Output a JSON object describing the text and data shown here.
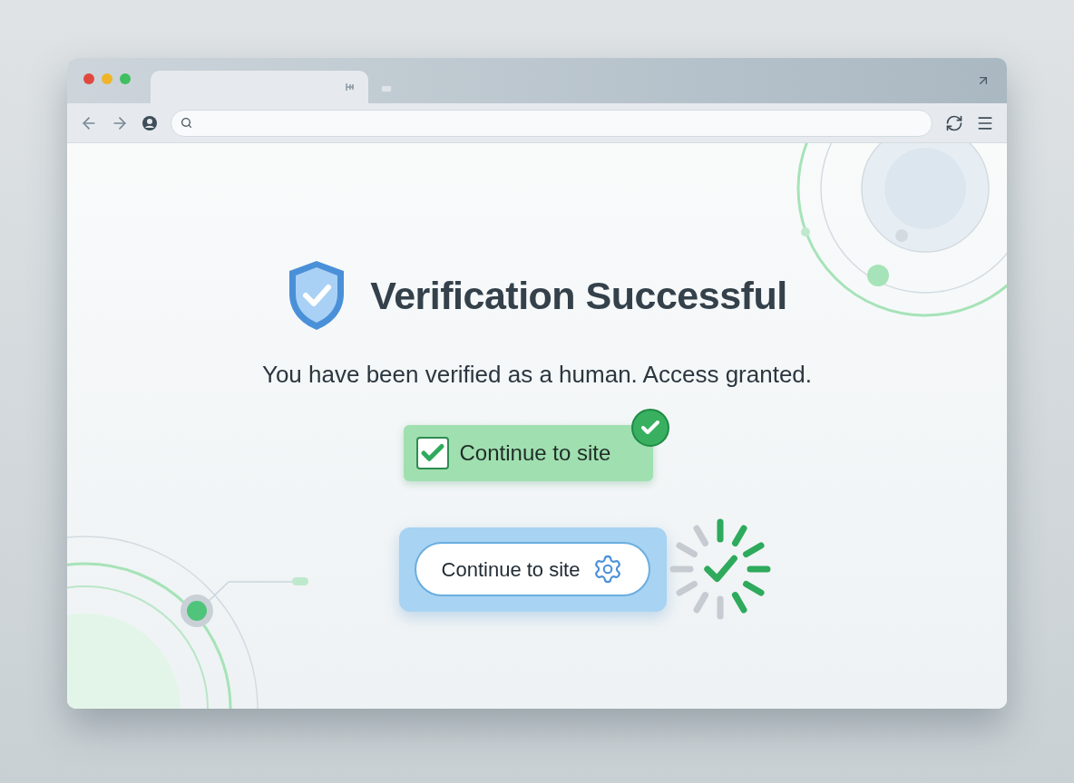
{
  "browser": {
    "tabs": [
      {
        "selected": true
      }
    ]
  },
  "page": {
    "heading": "Verification Successful",
    "message": "You have been verified as a human. Access granted.",
    "primary_button": {
      "label": "Continue to site",
      "checked": true
    },
    "secondary_button": {
      "label": "Continue to site"
    }
  }
}
